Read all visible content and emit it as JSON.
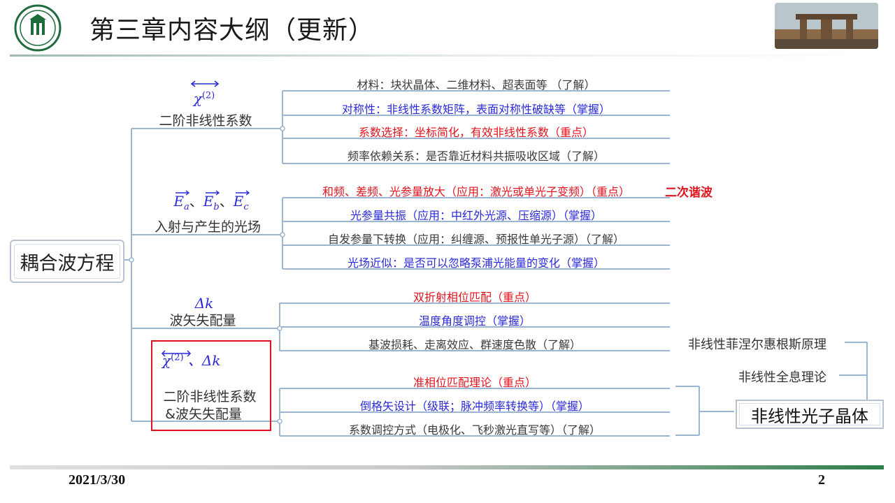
{
  "header": {
    "title": "第三章内容大纲（更新）"
  },
  "tree": {
    "root": "耦合波方程",
    "branches": [
      {
        "symbol": "χ(2)",
        "symbol_sup": "(2)",
        "symbol_base": "χ",
        "label": "二阶非线性系数",
        "leaves": [
          {
            "text": "材料：块状晶体、二维材料、超表面等 （了解）",
            "color": "black"
          },
          {
            "text": "对称性：非线性系数矩阵，表面对称性破缺等（掌握）",
            "color": "blue"
          },
          {
            "text": "系数选择：坐标简化，有效非线性系数（重点）",
            "color": "red"
          },
          {
            "text": "频率依赖关系：是否靠近材料共振吸收区域（了解）",
            "color": "black"
          }
        ]
      },
      {
        "symbol_a": "E",
        "sub_a": "a",
        "symbol_b": "E",
        "sub_b": "b",
        "symbol_c": "E",
        "sub_c": "c",
        "sep": "、",
        "label": "入射与产生的光场",
        "leaves": [
          {
            "text": "和频、差频、光参量放大（应用：激光或单光子变频）（重点）",
            "color": "red"
          },
          {
            "text": "光参量共振（应用：中红外光源、压缩源）（掌握）",
            "color": "blue"
          },
          {
            "text": "自发参量下转换（应用：纠缠源、预报性单光子源）（了解）",
            "color": "black"
          },
          {
            "text": "光场近似：是否可以忽略泵浦光能量的变化（掌握）",
            "color": "blue"
          }
        ],
        "note": "二次谐波"
      },
      {
        "symbol": "Δk",
        "label": "波矢失配量",
        "leaves": [
          {
            "text": "双折射相位匹配（重点）",
            "color": "red"
          },
          {
            "text": "温度角度调控（掌握）",
            "color": "blue"
          },
          {
            "text": "基波损耗、走离效应、群速度色散（了解）",
            "color": "black"
          }
        ]
      },
      {
        "symbol_base": "χ",
        "symbol_sup": "(2)",
        "symbol_tail": " 、Δk",
        "label_line1": "二阶非线性系数",
        "label_line2": "&波矢失配量",
        "leaves": [
          {
            "text": "准相位匹配理论（重点）",
            "color": "red"
          },
          {
            "text": "倒格矢设计（级联；脉冲频率转换等）（掌握）",
            "color": "blue"
          },
          {
            "text": "系数调控方式（电极化、飞秒激光直写等）（了解）",
            "color": "black"
          }
        ]
      }
    ],
    "right_nodes": [
      "非线性菲涅尔惠根斯原理",
      "非线性全息理论"
    ],
    "photonic_crystal": "非线性光子晶体"
  },
  "footer": {
    "date": "2021/3/30",
    "page": "2"
  },
  "colors": {
    "black": "#3a3a3a",
    "blue": "#2a2ad8",
    "red": "#e0141e",
    "connector": "#9bb5d3",
    "accent_green": "#2e7d4a"
  }
}
